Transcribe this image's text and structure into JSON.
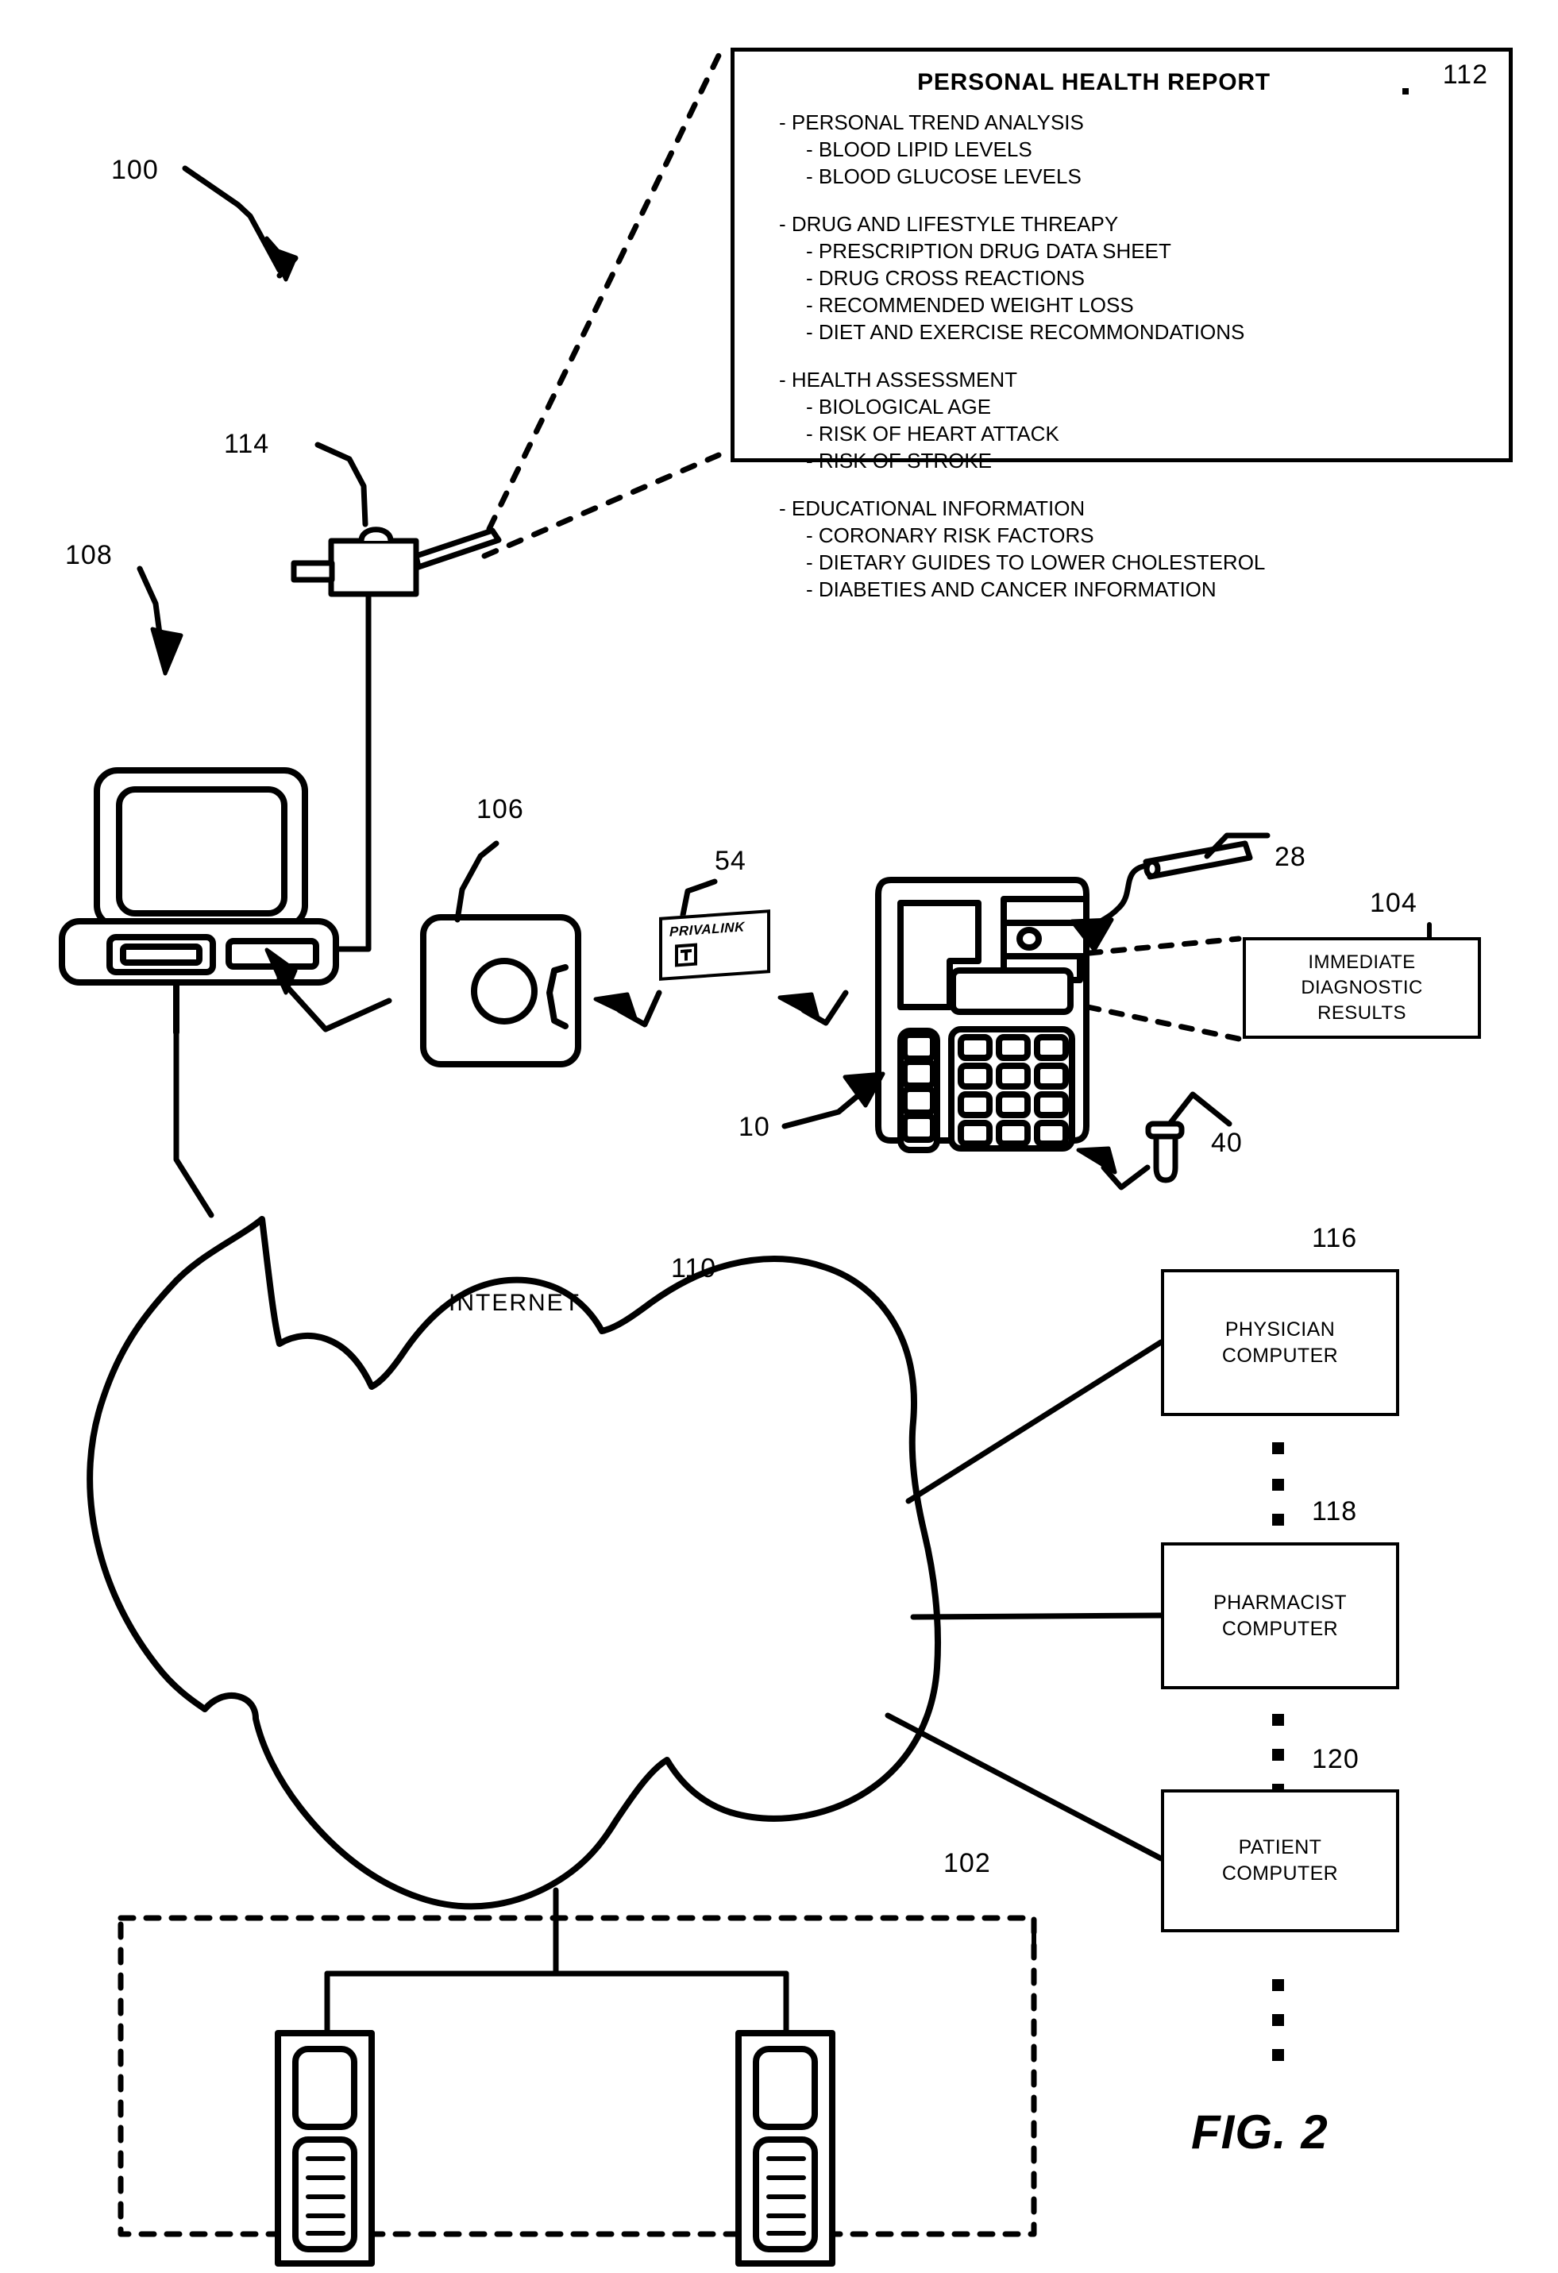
{
  "figure": {
    "caption": "FIG. 2"
  },
  "report": {
    "title": "PERSONAL HEALTH REPORT",
    "ref": "112",
    "groups": [
      {
        "head": "- PERSONAL TREND ANALYSIS",
        "items": [
          "- BLOOD LIPID LEVELS",
          "- BLOOD GLUCOSE LEVELS"
        ]
      },
      {
        "head": "- DRUG AND LIFESTYLE THREAPY",
        "items": [
          "- PRESCRIPTION DRUG DATA SHEET",
          "- DRUG CROSS REACTIONS",
          "- RECOMMENDED WEIGHT LOSS",
          "- DIET AND EXERCISE RECOMMONDATIONS"
        ]
      },
      {
        "head": "- HEALTH ASSESSMENT",
        "items": [
          "- BIOLOGICAL AGE",
          "- RISK OF HEART ATTACK",
          "- RISK OF STROKE"
        ]
      },
      {
        "head": "- EDUCATIONAL INFORMATION",
        "items": [
          "- CORONARY RISK FACTORS",
          "- DIETARY GUIDES TO LOWER CHOLESTEROL",
          "- DIABETIES AND CANCER INFORMATION"
        ]
      }
    ]
  },
  "nodes": {
    "immediate_results": {
      "line1": "IMMEDIATE",
      "line2": "DIAGNOSTIC",
      "line3": "RESULTS",
      "ref": "104"
    },
    "physician": {
      "line1": "PHYSICIAN",
      "line2": "COMPUTER",
      "ref": "116"
    },
    "pharmacist": {
      "line1": "PHARMACIST",
      "line2": "COMPUTER",
      "ref": "118"
    },
    "patient": {
      "line1": "PATIENT",
      "line2": "COMPUTER",
      "ref": "120"
    },
    "internet": {
      "label": "INTERNET",
      "ref": "110"
    }
  },
  "card": {
    "brand": "PRIVALINK",
    "ref": "54"
  },
  "reference_numerals": {
    "system": "100",
    "printer": "114",
    "home_computer": "108",
    "docking_station": "106",
    "meter": "10",
    "test_strip": "28",
    "lancet": "40",
    "handheld_group": "102"
  },
  "colors": {
    "ink": "#000000",
    "paper": "#ffffff"
  }
}
